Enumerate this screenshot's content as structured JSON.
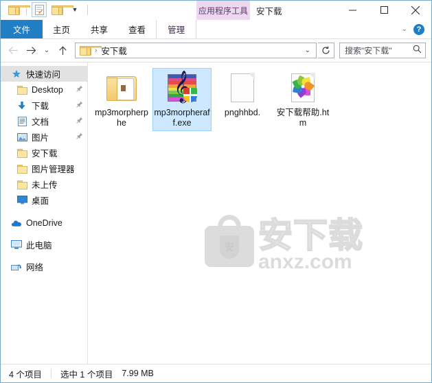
{
  "window": {
    "title": "安下载",
    "controls": {
      "minimize": "minimize-icon",
      "maximize": "maximize-icon",
      "close": "close-icon"
    }
  },
  "quick_access_toolbar": {
    "items": [
      {
        "name": "folder-icon",
        "label": ""
      },
      {
        "name": "properties-icon",
        "label": ""
      },
      {
        "name": "new-folder-icon",
        "label": ""
      },
      {
        "name": "customize-caret-icon",
        "label": "▾"
      }
    ]
  },
  "ribbon": {
    "contextual_group_label": "应用程序工具",
    "tabs": [
      {
        "label": "文件",
        "type": "file"
      },
      {
        "label": "主页",
        "type": "normal"
      },
      {
        "label": "共享",
        "type": "normal"
      },
      {
        "label": "查看",
        "type": "normal"
      },
      {
        "label": "管理",
        "type": "contextual"
      }
    ],
    "collapse_icon": "chevron-down-icon",
    "help_label": "?"
  },
  "addressbar": {
    "back": "back-arrow-icon",
    "forward": "forward-arrow-icon",
    "recent": "chevron-down-icon",
    "up": "up-arrow-icon",
    "breadcrumb": {
      "folder_icon": "folder-icon",
      "separator": "›",
      "path": "安下载"
    },
    "dropdown_caret": "chevron-down-icon",
    "refresh": "refresh-icon",
    "search": {
      "placeholder": "搜索\"安下载\"",
      "icon": "search-icon"
    }
  },
  "sidebar": {
    "items": [
      {
        "label": "快速访问",
        "icon": "pin-star-icon",
        "selected": true,
        "pinned": false,
        "indent": "root"
      },
      {
        "label": "Desktop",
        "icon": "folder-icon",
        "selected": false,
        "pinned": true,
        "indent": "child"
      },
      {
        "label": "下载",
        "icon": "download-arrow-icon",
        "selected": false,
        "pinned": true,
        "indent": "child"
      },
      {
        "label": "文档",
        "icon": "documents-icon",
        "selected": false,
        "pinned": true,
        "indent": "child"
      },
      {
        "label": "图片",
        "icon": "pictures-icon",
        "selected": false,
        "pinned": true,
        "indent": "child"
      },
      {
        "label": "安下载",
        "icon": "folder-icon",
        "selected": false,
        "pinned": false,
        "indent": "child"
      },
      {
        "label": "图片管理器",
        "icon": "folder-icon",
        "selected": false,
        "pinned": false,
        "indent": "child"
      },
      {
        "label": "未上传",
        "icon": "folder-icon",
        "selected": false,
        "pinned": false,
        "indent": "child"
      },
      {
        "label": "桌面",
        "icon": "desktop-icon",
        "selected": false,
        "pinned": false,
        "indent": "child"
      },
      {
        "label": "OneDrive",
        "icon": "onedrive-cloud-icon",
        "selected": false,
        "pinned": false,
        "indent": "root"
      },
      {
        "label": "此电脑",
        "icon": "this-pc-icon",
        "selected": false,
        "pinned": false,
        "indent": "root"
      },
      {
        "label": "网络",
        "icon": "network-icon",
        "selected": false,
        "pinned": false,
        "indent": "root"
      }
    ],
    "pin_glyph": "📌"
  },
  "files": [
    {
      "name": "mp3morpherphe",
      "icon": "folder-with-page-icon",
      "selected": false
    },
    {
      "name": "mp3morpheraff.exe",
      "icon": "mp3-morpher-app-icon",
      "selected": true
    },
    {
      "name": "pnghhbd.",
      "icon": "blank-page-icon",
      "selected": false
    },
    {
      "name": "安下载帮助.htm",
      "icon": "html-pinwheel-icon",
      "selected": false
    }
  ],
  "watermark": {
    "cn": "安下载",
    "en": "anxz.com",
    "shield_char": "安"
  },
  "statusbar": {
    "item_count": "4 个项目",
    "selection": "选中 1 个项目",
    "size": "7.99 MB"
  },
  "colors": {
    "file_tab_blue": "#1f7ec4",
    "contextual_purple": "#edd8f0",
    "selection_blue": "#cde8ff",
    "selection_border": "#99d1ff",
    "nav_selected_gray": "#e2e2e2",
    "window_border": "#7aa9c7"
  }
}
